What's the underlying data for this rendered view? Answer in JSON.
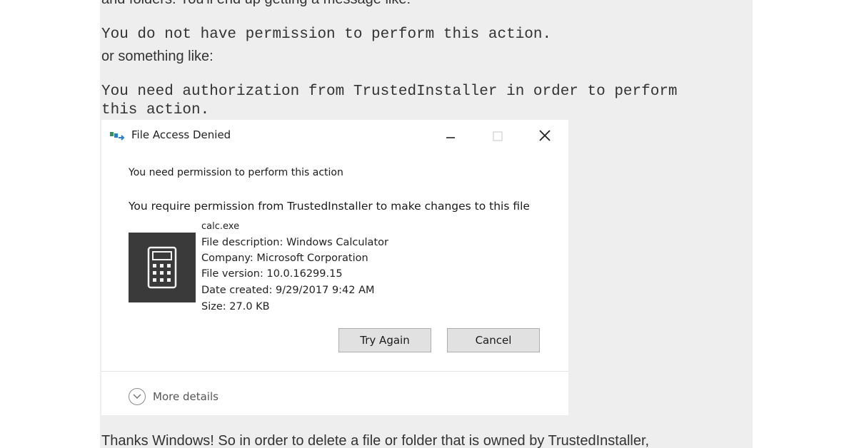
{
  "article": {
    "top_text": "and folders. You'll end up getting a message like:",
    "code_1": "You do not have permission to perform this action.",
    "middle_text": "or something like:",
    "code_2_line1": "You need authorization from TrustedInstaller in order to perform",
    "code_2_line2": "this action.",
    "bottom_text": "Thanks Windows! So in order to delete a file or folder that is owned by TrustedInstaller,"
  },
  "dialog": {
    "title": "File Access Denied",
    "heading": "You need permission to perform this action",
    "subheading": "You require permission from TrustedInstaller to make changes to this file",
    "file": {
      "name": "calc.exe",
      "description": "File description: Windows Calculator",
      "company": "Company: Microsoft Corporation",
      "version": "File version: 10.0.16299.15",
      "created": "Date created: 9/29/2017 9:42 AM",
      "size": "Size: 27.0 KB",
      "icon": "calculator-icon"
    },
    "buttons": {
      "try_again": "Try Again",
      "cancel": "Cancel"
    },
    "more_details": "More details",
    "window_controls": [
      "minimize-icon",
      "maximize-icon",
      "close-icon"
    ]
  },
  "colors": {
    "page_background": "#eeeeee",
    "dialog_background": "#ffffff",
    "button_face": "#e1e1e1",
    "file_icon_tile": "#3a3a3a"
  }
}
